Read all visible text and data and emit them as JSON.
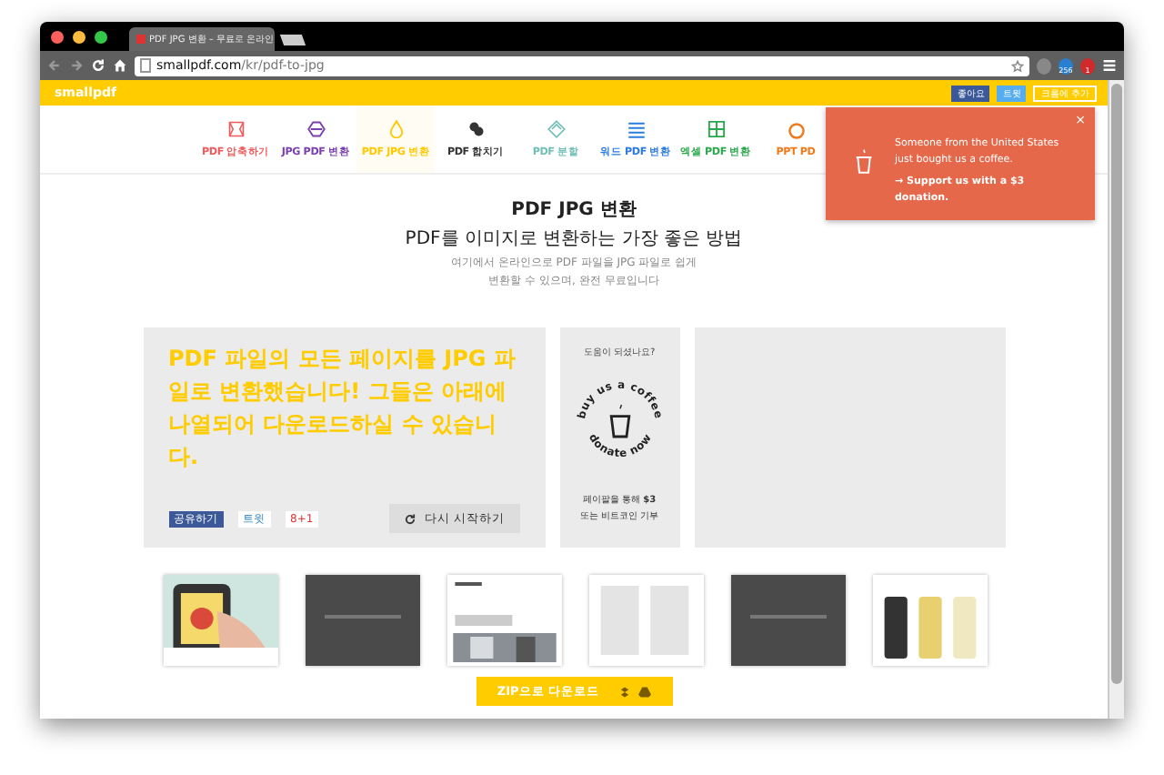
{
  "browser": {
    "tab": {
      "title": "PDF JPG 변환 – 무료로 온라인",
      "selected": true
    },
    "url_host": "smallpdf.com",
    "url_path": "/kr/pdf-to-jpg",
    "extension_badges": [
      "256",
      "1"
    ]
  },
  "topbar": {
    "logo": "smallpdf",
    "buttons": [
      {
        "kind": "facebook",
        "label": "좋아요"
      },
      {
        "kind": "twitter",
        "label": "트윗"
      },
      {
        "kind": "outline",
        "label": "크롬에 추가"
      }
    ]
  },
  "nav": [
    {
      "label": "PDF 압축하기",
      "color": "#f05a5a",
      "selected": false
    },
    {
      "label": "JPG PDF 변환",
      "color": "#7a3fb0",
      "selected": false
    },
    {
      "label": "PDF JPG 변환",
      "color": "#ffc800",
      "selected": true
    },
    {
      "label": "PDF 합치기",
      "color": "#333333",
      "selected": false
    },
    {
      "label": "PDF 분할",
      "color": "#6fbfb5",
      "selected": false
    },
    {
      "label": "워드 PDF 변환",
      "color": "#2b7be0",
      "selected": false
    },
    {
      "label": "엑셀 PDF 변환",
      "color": "#2aa84a",
      "selected": false
    },
    {
      "label": "PPT PD",
      "color": "#f07a1a",
      "selected": false
    }
  ],
  "hero": {
    "title": "PDF JPG 변환",
    "subtitle": "PDF를 이미지로 변환하는 가장 좋은 방법",
    "description": "여기에서 온라인으로 PDF 파일을 JPG 파일로 쉽게\n변환할 수 있으며, 완전 무료입니다"
  },
  "result": {
    "message": "PDF 파일의 모든 페이지를 JPG 파일로 변환했습니다! 그들은 아래에 나열되어 다운로드하실 수 있습니다.",
    "share": [
      {
        "kind": "facebook",
        "label": "공유하기"
      },
      {
        "kind": "twitter",
        "label": "트윗"
      },
      {
        "kind": "gplus",
        "label": "8+1"
      }
    ],
    "restart": "다시 시작하기"
  },
  "donate": {
    "question": "도움이 되셨나요?",
    "badge_top": "buy us a coffee",
    "badge_bottom": "donate now",
    "footer": "페이팔을 통해 **$3**\n또는 비트코인 기부"
  },
  "download": {
    "label": "ZIP으로 다운로드"
  },
  "notification": {
    "text": "Someone from the United States just bought us a coffee.",
    "link": "→ Support us with a $3 donation.",
    "close": "×"
  }
}
